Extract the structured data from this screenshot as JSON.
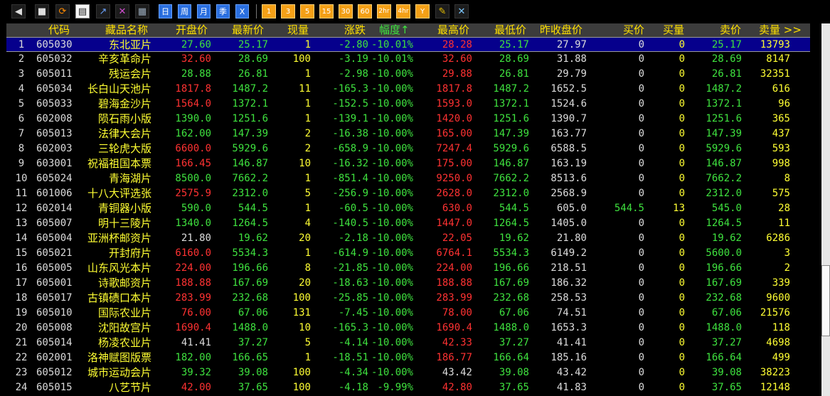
{
  "toolbar": {
    "icons": [
      "back-icon",
      "stamp-icon",
      "refresh-icon",
      "document-icon",
      "trend-icon",
      "chart-icon",
      "table-icon"
    ],
    "period_buttons": [
      "日",
      "周",
      "月",
      "季",
      "X"
    ],
    "minute_buttons": [
      "1",
      "3",
      "5",
      "15",
      "30",
      "60",
      "2hr",
      "4hr",
      "Y"
    ],
    "tool_icons": [
      "edit-icon",
      "tools-icon"
    ]
  },
  "table": {
    "headers": [
      "代码",
      "藏品名称",
      "开盘价",
      "最新价",
      "现量",
      "涨跌",
      "幅度↑",
      "最高价",
      "最低价",
      "昨收盘价",
      "买价",
      "买量",
      "卖价",
      "卖量 >>"
    ],
    "rows": [
      [
        "1",
        "605030",
        "东北亚片",
        "27.60",
        "25.17",
        "1",
        "-2.80",
        "-10.01%",
        "28.28",
        "25.17",
        "27.97",
        "0",
        "0",
        "25.17",
        "13793"
      ],
      [
        "2",
        "605032",
        "辛亥革命片",
        "32.60",
        "28.69",
        "100",
        "-3.19",
        "-10.01%",
        "32.60",
        "28.69",
        "31.88",
        "0",
        "0",
        "28.69",
        "8147"
      ],
      [
        "3",
        "605011",
        "残运会片",
        "28.88",
        "26.81",
        "1",
        "-2.98",
        "-10.00%",
        "29.88",
        "26.81",
        "29.79",
        "0",
        "0",
        "26.81",
        "32351"
      ],
      [
        "4",
        "605034",
        "长白山天池片",
        "1817.8",
        "1487.2",
        "11",
        "-165.3",
        "-10.00%",
        "1817.8",
        "1487.2",
        "1652.5",
        "0",
        "0",
        "1487.2",
        "616"
      ],
      [
        "5",
        "605033",
        "碧海金沙片",
        "1564.0",
        "1372.1",
        "1",
        "-152.5",
        "-10.00%",
        "1593.0",
        "1372.1",
        "1524.6",
        "0",
        "0",
        "1372.1",
        "96"
      ],
      [
        "6",
        "602008",
        "陨石雨小版",
        "1390.0",
        "1251.6",
        "1",
        "-139.1",
        "-10.00%",
        "1420.0",
        "1251.6",
        "1390.7",
        "0",
        "0",
        "1251.6",
        "365"
      ],
      [
        "7",
        "605013",
        "法律大会片",
        "162.00",
        "147.39",
        "2",
        "-16.38",
        "-10.00%",
        "165.00",
        "147.39",
        "163.77",
        "0",
        "0",
        "147.39",
        "437"
      ],
      [
        "8",
        "602003",
        "三轮虎大版",
        "6600.0",
        "5929.6",
        "2",
        "-658.9",
        "-10.00%",
        "7247.4",
        "5929.6",
        "6588.5",
        "0",
        "0",
        "5929.6",
        "593"
      ],
      [
        "9",
        "603001",
        "祝福祖国本票",
        "166.45",
        "146.87",
        "10",
        "-16.32",
        "-10.00%",
        "175.00",
        "146.87",
        "163.19",
        "0",
        "0",
        "146.87",
        "998"
      ],
      [
        "10",
        "605024",
        "青海湖片",
        "8500.0",
        "7662.2",
        "1",
        "-851.4",
        "-10.00%",
        "9250.0",
        "7662.2",
        "8513.6",
        "0",
        "0",
        "7662.2",
        "8"
      ],
      [
        "11",
        "601006",
        "十八大评选张",
        "2575.9",
        "2312.0",
        "5",
        "-256.9",
        "-10.00%",
        "2628.0",
        "2312.0",
        "2568.9",
        "0",
        "0",
        "2312.0",
        "575"
      ],
      [
        "12",
        "602014",
        "青铜器小版",
        "590.0",
        "544.5",
        "1",
        "-60.5",
        "-10.00%",
        "630.0",
        "544.5",
        "605.0",
        "544.5",
        "13",
        "545.0",
        "28"
      ],
      [
        "13",
        "605007",
        "明十三陵片",
        "1340.0",
        "1264.5",
        "4",
        "-140.5",
        "-10.00%",
        "1447.0",
        "1264.5",
        "1405.0",
        "0",
        "0",
        "1264.5",
        "11"
      ],
      [
        "14",
        "605004",
        "亚洲杯邮资片",
        "21.80",
        "19.62",
        "20",
        "-2.18",
        "-10.00%",
        "22.05",
        "19.62",
        "21.80",
        "0",
        "0",
        "19.62",
        "6286"
      ],
      [
        "15",
        "605021",
        "开封府片",
        "6160.0",
        "5534.3",
        "1",
        "-614.9",
        "-10.00%",
        "6764.1",
        "5534.3",
        "6149.2",
        "0",
        "0",
        "5600.0",
        "3"
      ],
      [
        "16",
        "605005",
        "山东风光本片",
        "224.00",
        "196.66",
        "8",
        "-21.85",
        "-10.00%",
        "224.00",
        "196.66",
        "218.51",
        "0",
        "0",
        "196.66",
        "2"
      ],
      [
        "17",
        "605001",
        "诗歌邮资片",
        "188.88",
        "167.69",
        "20",
        "-18.63",
        "-10.00%",
        "188.88",
        "167.69",
        "186.32",
        "0",
        "0",
        "167.69",
        "339"
      ],
      [
        "18",
        "605017",
        "古镇碛口本片",
        "283.99",
        "232.68",
        "100",
        "-25.85",
        "-10.00%",
        "283.99",
        "232.68",
        "258.53",
        "0",
        "0",
        "232.68",
        "9600"
      ],
      [
        "19",
        "605010",
        "国际农业片",
        "76.00",
        "67.06",
        "131",
        "-7.45",
        "-10.00%",
        "78.00",
        "67.06",
        "74.51",
        "0",
        "0",
        "67.06",
        "21576"
      ],
      [
        "20",
        "605008",
        "沈阳故宫片",
        "1690.4",
        "1488.0",
        "10",
        "-165.3",
        "-10.00%",
        "1690.4",
        "1488.0",
        "1653.3",
        "0",
        "0",
        "1488.0",
        "118"
      ],
      [
        "21",
        "605014",
        "杨凌农业片",
        "41.41",
        "37.27",
        "5",
        "-4.14",
        "-10.00%",
        "42.33",
        "37.27",
        "41.41",
        "0",
        "0",
        "37.27",
        "4698"
      ],
      [
        "22",
        "602001",
        "洛神赋图版票",
        "182.00",
        "166.65",
        "1",
        "-18.51",
        "-10.00%",
        "186.77",
        "166.64",
        "185.16",
        "0",
        "0",
        "166.64",
        "499"
      ],
      [
        "23",
        "605012",
        "城市运动会片",
        "39.32",
        "39.08",
        "100",
        "-4.34",
        "-10.00%",
        "43.42",
        "39.08",
        "43.42",
        "0",
        "0",
        "39.08",
        "38223"
      ],
      [
        "24",
        "605015",
        "八艺节片",
        "42.00",
        "37.65",
        "100",
        "-4.18",
        "-9.99%",
        "42.80",
        "37.65",
        "41.83",
        "0",
        "0",
        "37.65",
        "12148"
      ]
    ],
    "open_colors": [
      "G",
      "R",
      "G",
      "R",
      "R",
      "G",
      "G",
      "R",
      "R",
      "G",
      "R",
      "G",
      "G",
      "W",
      "R",
      "R",
      "R",
      "R",
      "R",
      "R",
      "W",
      "G",
      "G",
      "R"
    ],
    "high_colors": [
      "R",
      "R",
      "R",
      "R",
      "R",
      "R",
      "R",
      "R",
      "R",
      "R",
      "R",
      "R",
      "R",
      "R",
      "R",
      "R",
      "R",
      "R",
      "R",
      "R",
      "R",
      "R",
      "W",
      "R"
    ],
    "selected_row": 0
  },
  "colors": {
    "up": "#ff3232",
    "down": "#3fe23f",
    "header": "#ffe000",
    "selected": "#06008c"
  }
}
